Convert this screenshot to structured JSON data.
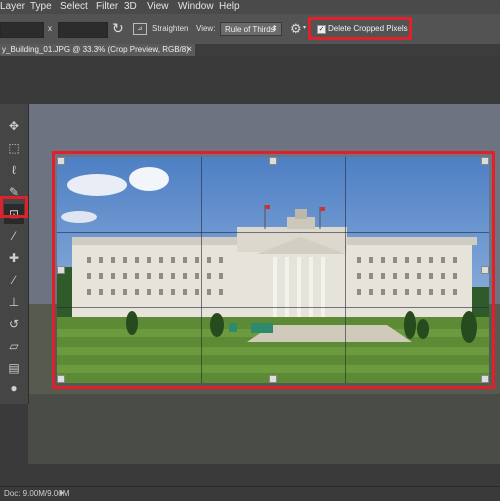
{
  "menu": [
    "Layer",
    "Type",
    "Select",
    "Filter",
    "3D",
    "View",
    "Window",
    "Help"
  ],
  "options": {
    "x_label": "x",
    "straighten_label": "Straighten",
    "view_label": "View:",
    "view_value": "Rule of Thirds",
    "delete_cropped_label": "Delete Cropped Pixels",
    "delete_cropped_checked": true
  },
  "document_tab": {
    "title": "y_Building_01.JPG @ 33.3% (Crop Preview, RGB/8)",
    "close": "×"
  },
  "status": {
    "doc_size": "Doc: 9.00M/9.00M"
  },
  "colors": {
    "highlight": "#e0202a",
    "sky": "#5f8fcd",
    "lawn": "#5c8a35",
    "building": "#e8e6df"
  },
  "tools": [
    "move-icon",
    "marquee-icon",
    "lasso-icon",
    "quick-selection-icon",
    "crop-icon",
    "eyedropper-icon",
    "healing-brush-icon",
    "brush-icon",
    "clone-stamp-icon",
    "history-brush-icon",
    "eraser-icon",
    "gradient-icon",
    "blur-icon",
    "dodge-icon"
  ]
}
